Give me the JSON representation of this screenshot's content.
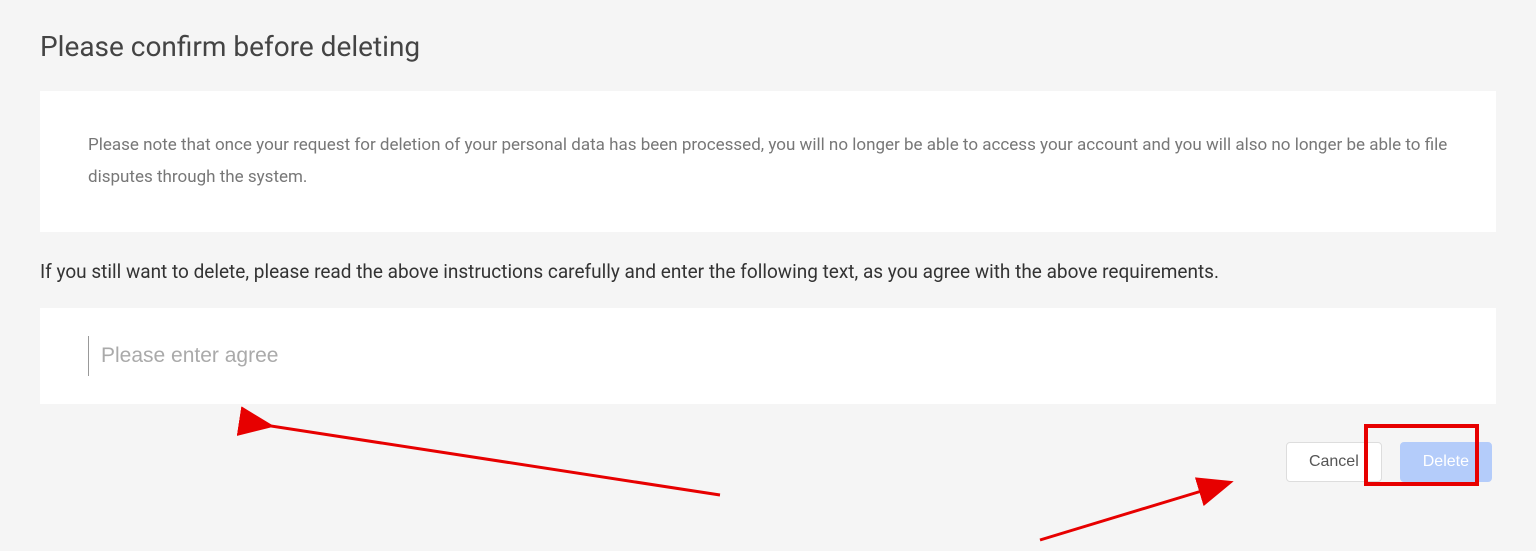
{
  "title": "Please confirm before deleting",
  "notice": "Please note that once your request for deletion of your personal data has been processed, you will no longer be able to access your account and you will also no longer be able to file disputes through the system.",
  "instruction": "If you still want to delete, please read the above instructions carefully and enter the following text, as you agree with the above requirements.",
  "input": {
    "placeholder": "Please enter agree",
    "value": ""
  },
  "buttons": {
    "cancel": "Cancel",
    "delete": "Delete"
  }
}
